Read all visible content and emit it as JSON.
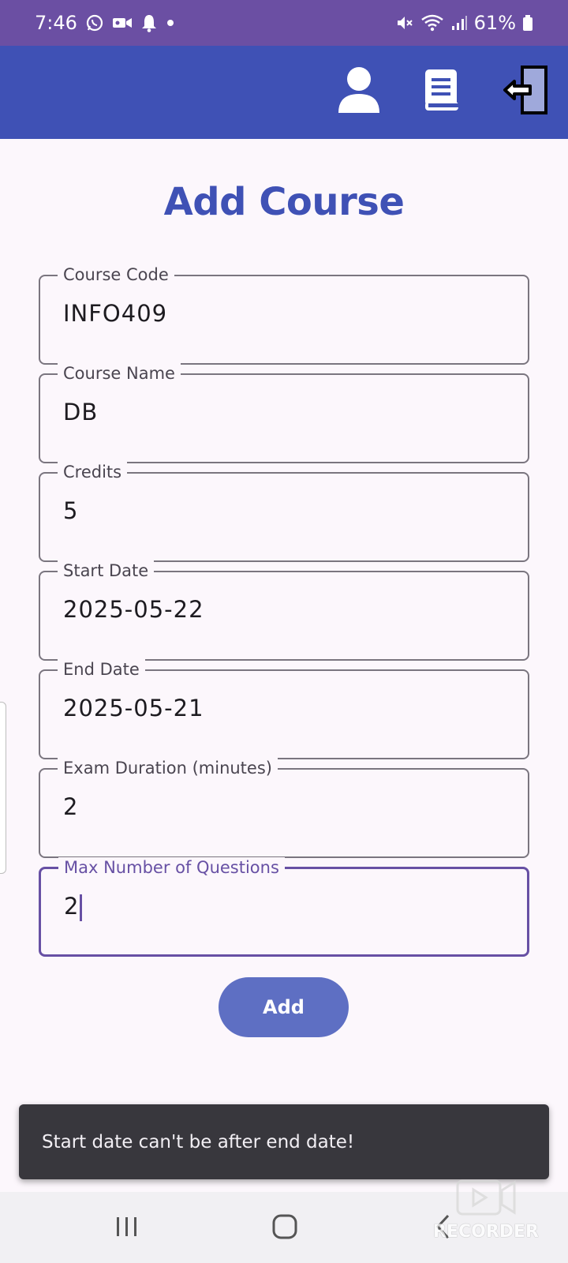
{
  "status_bar": {
    "time": "7:46",
    "battery": "61%",
    "icons": [
      "whatsapp-icon",
      "video-icon",
      "bell-icon",
      "dot-icon",
      "mute-icon",
      "wifi-icon",
      "signal-icon",
      "battery-icon"
    ]
  },
  "app_bar": {
    "actions": [
      "profile-icon",
      "book-icon",
      "logout-icon"
    ]
  },
  "page": {
    "title": "Add Course"
  },
  "form": {
    "course_code": {
      "label": "Course Code",
      "value": "INFO409"
    },
    "course_name": {
      "label": "Course Name",
      "value": "DB"
    },
    "credits": {
      "label": "Credits",
      "value": "5"
    },
    "start_date": {
      "label": "Start Date",
      "value": "2025-05-22"
    },
    "end_date": {
      "label": "End Date",
      "value": "2025-05-21"
    },
    "exam_duration": {
      "label": "Exam Duration (minutes)",
      "value": "2"
    },
    "max_questions": {
      "label": "Max Number of Questions",
      "value": "2"
    },
    "submit_label": "Add"
  },
  "snackbar": {
    "message": "Start date can't be after end date!"
  },
  "watermark": {
    "text": "RECORDER"
  },
  "colors": {
    "status_bar": "#6b4fa3",
    "app_bar": "#3f51b5",
    "title": "#3f51b5",
    "button": "#5e6fc3",
    "focus": "#6750a4",
    "snackbar": "#38373d"
  }
}
